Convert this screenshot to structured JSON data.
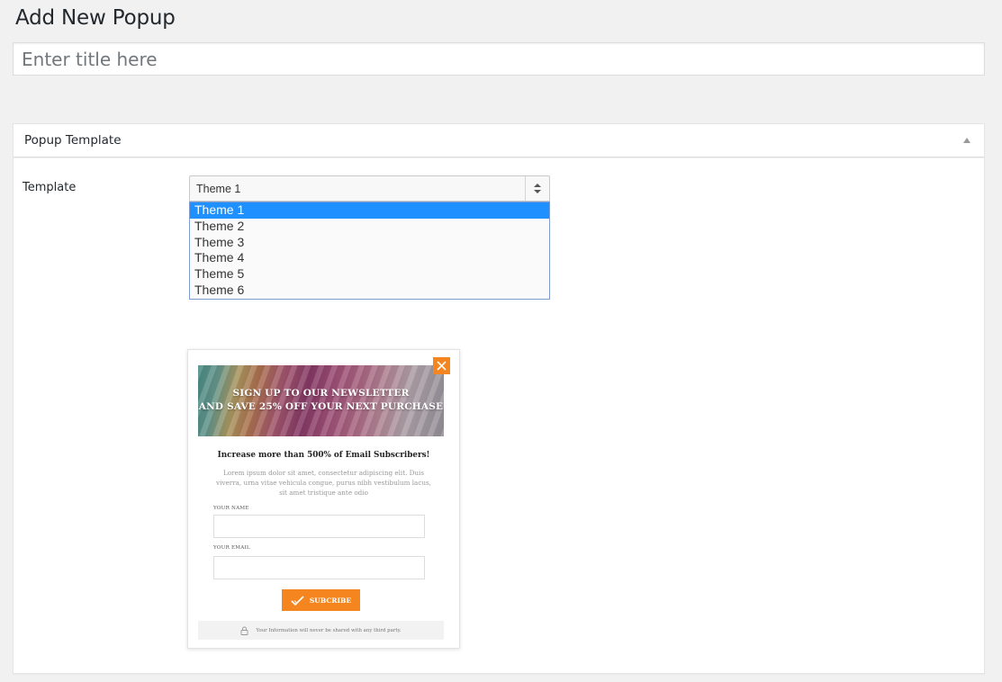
{
  "page": {
    "title": "Add New Popup"
  },
  "title_field": {
    "placeholder": "Enter title here",
    "value": ""
  },
  "metabox": {
    "title": "Popup Template",
    "toggle_icon": "triangle-up-icon",
    "template_label": "Template",
    "select": {
      "selected": "Theme 1",
      "arrow_icon": "updown-arrows-icon",
      "options": [
        "Theme 1",
        "Theme 2",
        "Theme 3",
        "Theme 4",
        "Theme 5",
        "Theme 6"
      ]
    }
  },
  "preview": {
    "banner_line1": "SIGN UP TO OUR NEWSLETTER",
    "banner_line2": "AND SAVE 25% OFF YOUR NEXT PURCHASE",
    "close_icon": "close-x-icon",
    "headline": "Increase more than 500% of Email Subscribers!",
    "body": "Lorem ipsum dolor sit amet, consectetur adipiscing elit. Duis viverra, urna vitae vehicula congue, purus nibh vestibulum lacus, sit amet tristique ante odio",
    "name_label": "YOUR NAME",
    "email_label": "YOUR EMAIL",
    "button_label": "SUBCRIBE",
    "button_icon": "checkmark-icon",
    "privacy_icon": "lock-icon",
    "privacy_text": "Your Information will never be shared with any third party."
  },
  "colors": {
    "accent": "#f5861f",
    "selection": "#1e90ff",
    "background": "#f1f1f1"
  }
}
